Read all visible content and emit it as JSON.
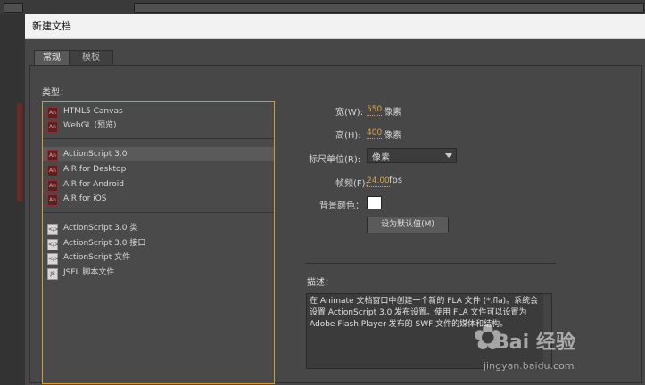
{
  "dialog": {
    "title": "新建文档"
  },
  "tabs": [
    {
      "label": "常规"
    },
    {
      "label": "模板"
    }
  ],
  "type_label": "类型：",
  "types": [
    {
      "label": "HTML5 Canvas",
      "icon": "animate-doc-icon"
    },
    {
      "label": "WebGL (预览)",
      "icon": "animate-doc-icon"
    },
    {
      "label": "ActionScript 3.0",
      "icon": "animate-doc-icon",
      "selected": true
    },
    {
      "label": "AIR for Desktop",
      "icon": "animate-doc-icon"
    },
    {
      "label": "AIR for Android",
      "icon": "animate-doc-icon"
    },
    {
      "label": "AIR for iOS",
      "icon": "animate-doc-icon"
    },
    {
      "label": "ActionScript 3.0 类",
      "icon": "script-file-icon"
    },
    {
      "label": "ActionScript 3.0 接口",
      "icon": "script-file-icon"
    },
    {
      "label": "ActionScript 文件",
      "icon": "script-file-icon"
    },
    {
      "label": "JSFL 脚本文件",
      "icon": "jsfl-file-icon"
    }
  ],
  "form": {
    "width_label": "宽(W):",
    "width_value": "550",
    "width_unit": "像素",
    "height_label": "高(H):",
    "height_value": "400",
    "height_unit": "像素",
    "ruler_label": "标尺单位(R):",
    "ruler_value": "像素",
    "fps_label": "帧频(F):",
    "fps_value": "24.00",
    "fps_unit": "fps",
    "bg_label": "背景颜色：",
    "bg_color": "#ffffff",
    "default_button": "设为默认值(M)"
  },
  "description": {
    "label": "描述：",
    "text": "在 Animate 文档窗口中创建一个新的 FLA 文件 (*.fla)。系统会设置 ActionScript 3.0 发布设置。使用 FLA 文件可以设置为 Adobe Flash Player 发布的 SWF 文件的媒体和结构。"
  },
  "watermark": {
    "brand": "Bai 经验",
    "url": "jingyan.baidu.com"
  }
}
